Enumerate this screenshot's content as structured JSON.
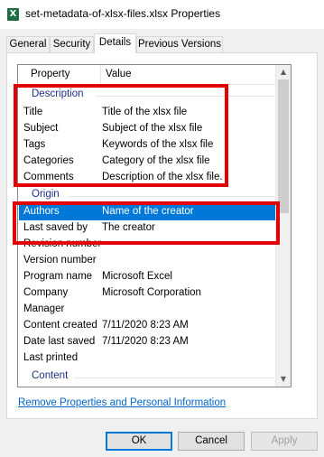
{
  "window": {
    "title": "set-metadata-of-xlsx-files.xlsx Properties",
    "icon": "excel-file-icon"
  },
  "tabs": [
    {
      "label": "General",
      "active": false
    },
    {
      "label": "Security",
      "active": false
    },
    {
      "label": "Details",
      "active": true
    },
    {
      "label": "Previous Versions",
      "active": false
    }
  ],
  "list": {
    "headers": {
      "property": "Property",
      "value": "Value"
    },
    "groups": {
      "description": "Description",
      "origin": "Origin",
      "content": "Content"
    },
    "description_rows": [
      {
        "key": "Title",
        "value": "Title of the xlsx file"
      },
      {
        "key": "Subject",
        "value": "Subject of the xlsx file"
      },
      {
        "key": "Tags",
        "value": "Keywords of the xlsx file"
      },
      {
        "key": "Categories",
        "value": "Category of the xlsx file"
      },
      {
        "key": "Comments",
        "value": "Description of the xlsx file."
      }
    ],
    "origin_rows": [
      {
        "key": "Authors",
        "value": "Name of the creator",
        "selected": true
      },
      {
        "key": "Last saved by",
        "value": "The creator"
      },
      {
        "key": "Revision number",
        "value": ""
      },
      {
        "key": "Version number",
        "value": ""
      },
      {
        "key": "Program name",
        "value": "Microsoft Excel"
      },
      {
        "key": "Company",
        "value": "Microsoft Corporation"
      },
      {
        "key": "Manager",
        "value": ""
      },
      {
        "key": "Content created",
        "value": "7/11/2020 8:23 AM"
      },
      {
        "key": "Date last saved",
        "value": "7/11/2020 8:23 AM"
      },
      {
        "key": "Last printed",
        "value": ""
      }
    ]
  },
  "link": {
    "label": "Remove Properties and Personal Information"
  },
  "buttons": {
    "ok": "OK",
    "cancel": "Cancel",
    "apply": "Apply"
  },
  "colors": {
    "selection": "#0078d7",
    "highlight_box": "#e20000",
    "group_text": "#1e3287",
    "link": "#0066cc"
  }
}
